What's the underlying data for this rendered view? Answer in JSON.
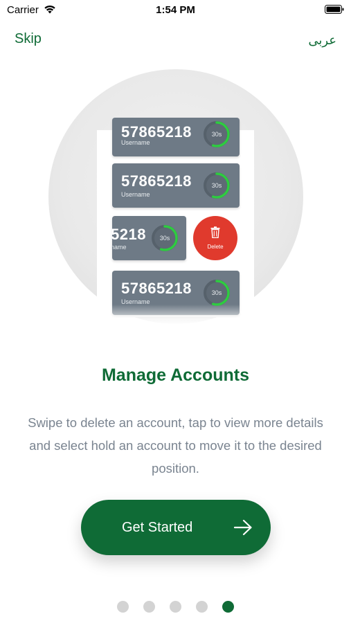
{
  "status_bar": {
    "carrier": "Carrier",
    "time": "1:54 PM"
  },
  "nav": {
    "skip_label": "Skip",
    "language_label": "عربى"
  },
  "illustration": {
    "cards": [
      {
        "number": "57865218",
        "username": "Username",
        "timer": "30s",
        "progress": 0.55
      },
      {
        "number": "57865218",
        "username": "Username",
        "timer": "30s",
        "progress": 0.55
      },
      {
        "number": "5218",
        "username": "name",
        "timer": "30s",
        "progress": 0.55
      },
      {
        "number": "57865218",
        "username": "Username",
        "timer": "30s",
        "progress": 0.55
      }
    ],
    "delete_label": "Delete"
  },
  "onboarding": {
    "title": "Manage Accounts",
    "description": "Swipe to delete an account, tap to view more details and select hold an account to move it to the desired position."
  },
  "cta": {
    "label": "Get Started"
  },
  "pagination": {
    "total": 5,
    "active_index": 4
  },
  "colors": {
    "brand_green": "#0f6b36",
    "card_gray": "#6e7a86",
    "timer_green": "#2ecc40",
    "delete_red": "#e03a2d",
    "dot_inactive": "#d3d3d3"
  }
}
